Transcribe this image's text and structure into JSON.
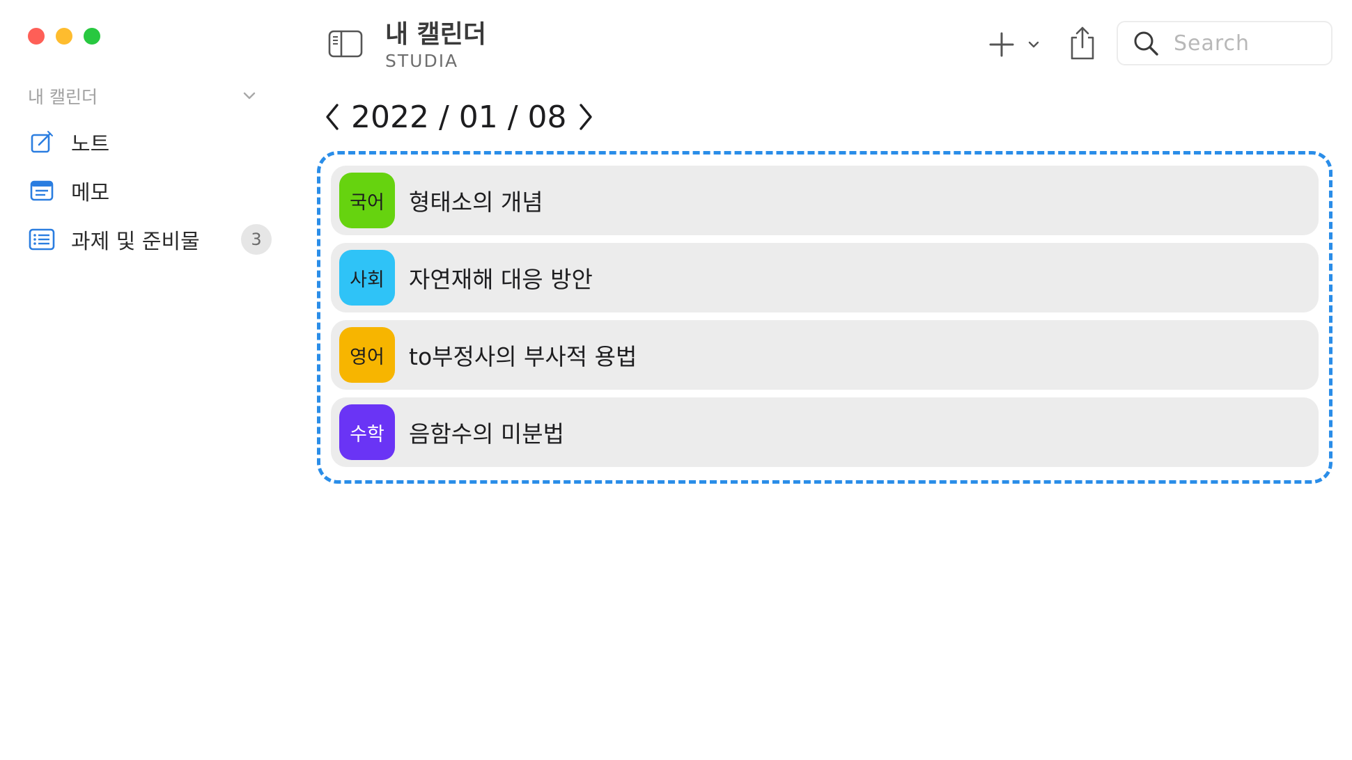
{
  "sidebar": {
    "section_title": "내 캘린더",
    "items": [
      {
        "label": "노트",
        "icon": "note-compose-icon"
      },
      {
        "label": "메모",
        "icon": "memo-icon"
      },
      {
        "label": "과제 및 준비물",
        "icon": "list-icon",
        "count": "3"
      }
    ]
  },
  "header": {
    "title": "내 캘린더",
    "subtitle": "STUDIA"
  },
  "search": {
    "placeholder": "Search"
  },
  "date_nav": {
    "date": "2022 / 01 / 08"
  },
  "entries": [
    {
      "subject": "국어",
      "title": "형태소의 개념",
      "color": "#66d30f",
      "subject_color": "#1d1d1f"
    },
    {
      "subject": "사회",
      "title": "자연재해 대응 방안",
      "color": "#2fc3f7",
      "subject_color": "#1d1d1f"
    },
    {
      "subject": "영어",
      "title": "to부정사의 부사적 용법",
      "color": "#f7b500",
      "subject_color": "#1d1d1f"
    },
    {
      "subject": "수학",
      "title": "음함수의 미분법",
      "color": "#6a34f5",
      "subject_color": "#ffffff"
    }
  ],
  "colors": {
    "accent": "#2a8de8",
    "close": "#fe5f57",
    "minimize": "#febc2e",
    "zoom": "#28c840"
  }
}
